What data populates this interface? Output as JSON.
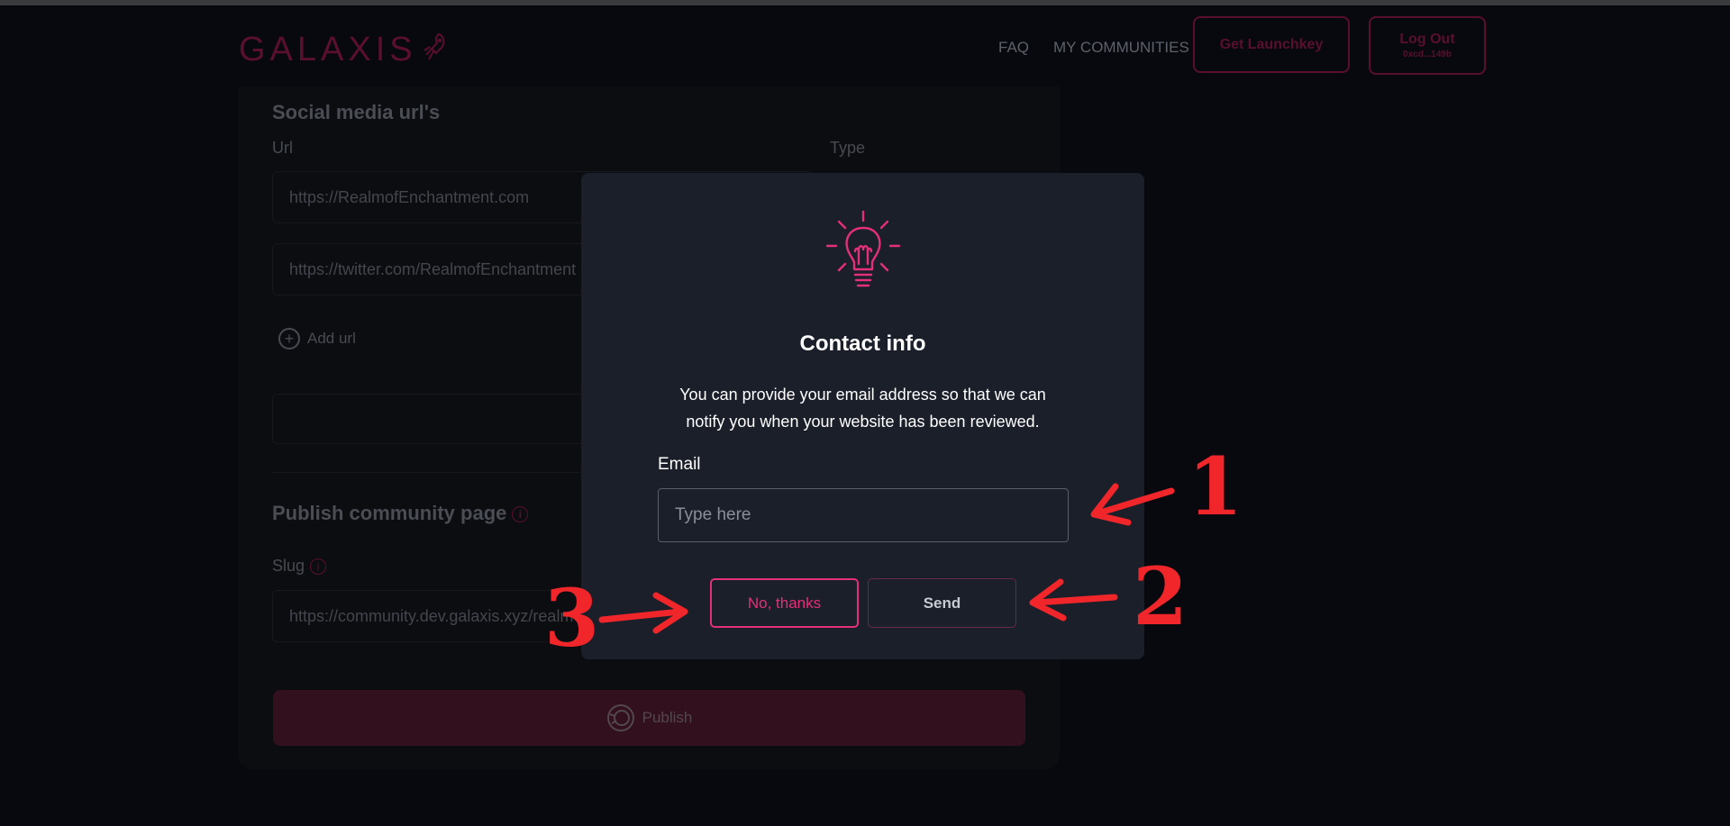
{
  "header": {
    "logo_text": "GALAXIS",
    "nav": {
      "faq": "FAQ",
      "my_communities": "MY COMMUNITIES"
    },
    "launchkey_button": "Get Launchkey",
    "logout": {
      "label": "Log Out",
      "address": "0xcd...149b"
    }
  },
  "form": {
    "social_section_title": "Social media url's",
    "url_column_label": "Url",
    "type_column_label": "Type",
    "urls": [
      "https://RealmofEnchantment.com",
      "https://twitter.com/RealmofEnchantment"
    ],
    "add_url_label": "Add url",
    "publish_section_title": "Publish community page",
    "slug_label": "Slug",
    "slug_value": "https://community.dev.galaxis.xyz/realmofenchantment",
    "publish_button": "Publish"
  },
  "modal": {
    "icon": "lightbulb-icon",
    "title": "Contact info",
    "description": "You can provide your email address so that we can notify you when your website has been reviewed.",
    "email_label": "Email",
    "email_placeholder": "Type here",
    "email_value": "",
    "no_thanks_button": "No, thanks",
    "send_button": "Send"
  },
  "annotations": {
    "one": "1",
    "two": "2",
    "three": "3"
  },
  "colors": {
    "accent": "#e42f7a",
    "dim_accent": "#5a0f2e",
    "modal_bg": "#1a1f2a",
    "page_bg": "#07090f",
    "annotation_red": "#f0262b"
  }
}
